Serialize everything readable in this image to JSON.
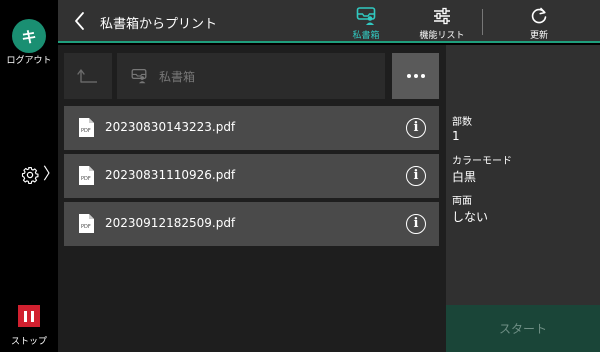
{
  "rail": {
    "logout_glyph": "キ",
    "logout_label": "ログアウト",
    "stop_label": "ストップ",
    "chevron": "〉"
  },
  "header": {
    "title": "私書箱からプリント",
    "mailbox_label": "私書箱",
    "function_list_label": "機能リスト",
    "refresh_label": "更新"
  },
  "path": {
    "current": "私書箱"
  },
  "files": [
    {
      "name": "20230830143223.pdf"
    },
    {
      "name": "20230831110926.pdf"
    },
    {
      "name": "20230912182509.pdf"
    }
  ],
  "settings": {
    "copies_label": "部数",
    "copies_value": "1",
    "color_mode_label": "カラーモード",
    "color_mode_value": "白黒",
    "duplex_label": "両面",
    "duplex_value": "しない"
  },
  "start_label": "スタート",
  "colors": {
    "accent": "#1f9f7d",
    "active_tab": "#31c9c1",
    "stop": "#d1202f",
    "start_disabled": "#1a4538"
  },
  "icons": {
    "file": "pdf-file-icon",
    "info": "info-icon",
    "mailbox": "mailbox-icon",
    "function_list": "sliders-icon",
    "refresh": "refresh-icon",
    "back": "back-arrow-icon",
    "up": "up-folder-icon",
    "more": "more-icon",
    "settings": "gear-icon"
  }
}
